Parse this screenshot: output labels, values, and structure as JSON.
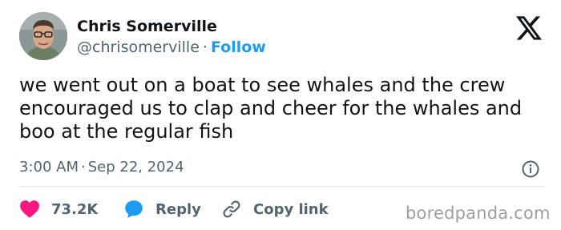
{
  "author": {
    "name": "Chris Somerville",
    "handle": "@chrisomerville",
    "separator": "·",
    "follow_label": "Follow"
  },
  "tweet": {
    "text": "we went out on a boat to see whales and the crew encouraged us to clap and cheer for the whales and boo at the regular fish",
    "time": "3:00 AM",
    "separator": "·",
    "date": "Sep 22, 2024"
  },
  "actions": {
    "likes_count": "73.2K",
    "reply_label": "Reply",
    "copy_label": "Copy link"
  },
  "watermark": "boredpanda.com",
  "colors": {
    "text": "#0f1419",
    "secondary": "#536471",
    "accent": "#1d9bf0",
    "like": "#f91880",
    "divider": "#e3e7ea"
  },
  "icons": {
    "platform": "x-logo-icon",
    "info": "info-icon",
    "like": "heart-icon",
    "reply": "speech-bubble-icon",
    "copy": "link-icon"
  }
}
